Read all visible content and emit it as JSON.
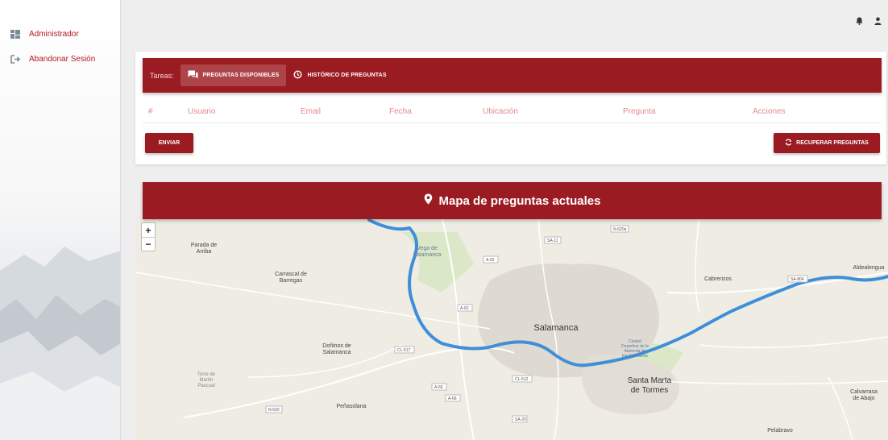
{
  "sidebar": {
    "items": [
      {
        "label": "Administrador",
        "icon": "dashboard-icon"
      },
      {
        "label": "Abandonar Sesión",
        "icon": "sign-out-icon"
      }
    ]
  },
  "header": {
    "icons": [
      "bell-icon",
      "user-icon"
    ]
  },
  "tasks": {
    "label": "Tareas:",
    "tabs": [
      {
        "label": "PREGUNTAS DISPONIBLES",
        "icon": "chat-icon",
        "active": true
      },
      {
        "label": "HISTÓRICO DE PREGUNTAS",
        "icon": "history-icon",
        "active": false
      }
    ]
  },
  "table": {
    "columns": [
      "#",
      "Usuario",
      "Email",
      "Fecha",
      "Ubicación",
      "Pregunta",
      "Acciones"
    ]
  },
  "buttons": {
    "send": "ENVIAR",
    "recover": "RECUPERAR PREGUNTAS"
  },
  "map": {
    "title": "Mapa de preguntas actuales",
    "zoom_in": "+",
    "zoom_out": "−",
    "labels": {
      "parada": "Parada de",
      "parada2": "Arriba",
      "carrascal": "Carrascal de",
      "carrascal2": "Barregas",
      "vega": "Vega de",
      "vega2": "Salamanca",
      "salamanca": "Salamanca",
      "cabrerizos": "Cabrerizos",
      "aldealengua": "Aldealengua",
      "donhinos": "Doñinos de",
      "donhinos2": "Salamanca",
      "torre": "Torre de",
      "torre2": "Martín",
      "torre3": "Pascual",
      "santamarta": "Santa Marta",
      "santamarta2": "de Tormes",
      "calvarrasa": "Calvarrasa",
      "calvarrasa2": "de Abajo",
      "penasolana": "Peñasolana",
      "pelabravo": "Pelabravo",
      "ciudad1": "Ciudad",
      "ciudad2": "Deportiva de la",
      "ciudad3": "Alameda de",
      "ciudad4": "los Guzmanes"
    },
    "roads": {
      "n620a": "N-620a",
      "sa11": "SA-11",
      "a62a": "A-62",
      "a62b": "A-62",
      "sa804": "SA-804",
      "cl517": "CL-517",
      "cl512": "CL-512",
      "a66a": "A-66",
      "a66b": "A-66",
      "n620": "N-620",
      "sa20": "SA-20"
    }
  },
  "colors": {
    "brand": "#9b1b22",
    "water": "#3f8fd8"
  }
}
